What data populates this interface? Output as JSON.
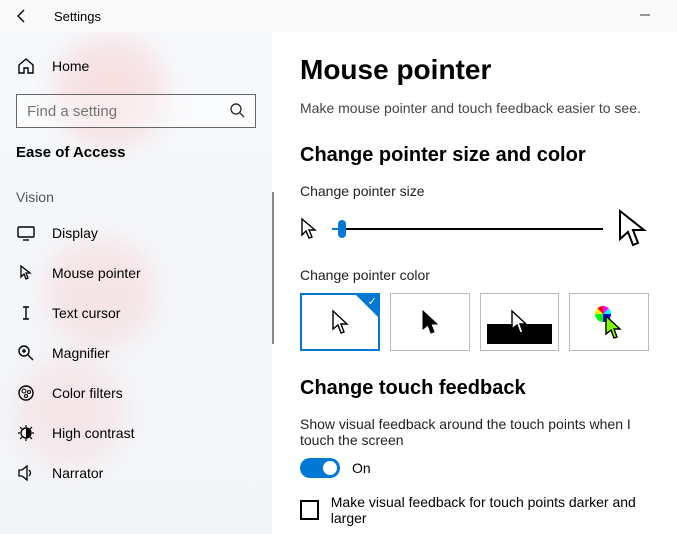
{
  "titlebar": {
    "app_title": "Settings"
  },
  "sidebar": {
    "home_label": "Home",
    "search_placeholder": "Find a setting",
    "section_title": "Ease of Access",
    "group_label": "Vision",
    "items": [
      {
        "label": "Display"
      },
      {
        "label": "Mouse pointer"
      },
      {
        "label": "Text cursor"
      },
      {
        "label": "Magnifier"
      },
      {
        "label": "Color filters"
      },
      {
        "label": "High contrast"
      },
      {
        "label": "Narrator"
      }
    ]
  },
  "main": {
    "heading": "Mouse pointer",
    "subtitle": "Make mouse pointer and touch feedback easier to see.",
    "size_color_heading": "Change pointer size and color",
    "size_label": "Change pointer size",
    "color_label": "Change pointer color",
    "touch_heading": "Change touch feedback",
    "touch_desc": "Show visual feedback around the touch points when I touch the screen",
    "toggle_state": "On",
    "checkbox_label": "Make visual feedback for touch points darker and larger"
  }
}
